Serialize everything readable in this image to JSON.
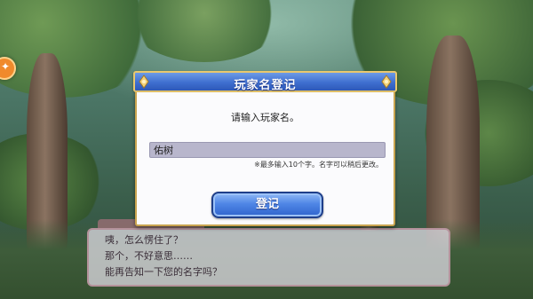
{
  "modal": {
    "title": "玩家名登记",
    "prompt": "请输入玩家名。",
    "input_value": "佑树",
    "note": "※最多输入10个字。名字可以稍后更改。",
    "submit_label": "登记"
  },
  "dialog": {
    "lines": [
      "咦，怎么愣住了？",
      "那个，不好意思……",
      "能再告知一下您的名字吗？"
    ]
  },
  "colors": {
    "header_blue": "#3f6fd0",
    "frame_gold": "#c9a44f",
    "input_bg": "#b8b6cc"
  }
}
